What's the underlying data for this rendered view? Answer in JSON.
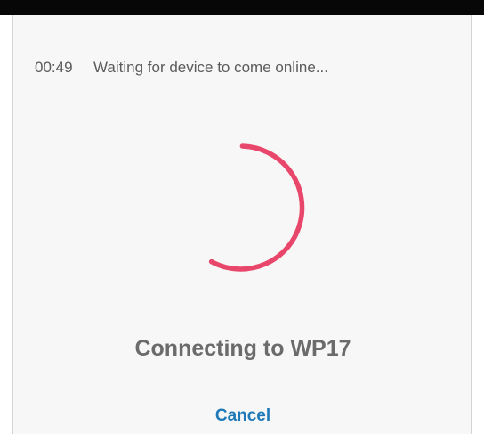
{
  "status": {
    "timer": "00:49",
    "message": "Waiting for device to come online..."
  },
  "spinner": {
    "icon": "loading-spinner-icon",
    "color": "#e8476b"
  },
  "dialog": {
    "title": "Connecting to WP17",
    "cancel_label": "Cancel"
  },
  "colors": {
    "accent": "#1e79b8",
    "background": "#f7f7f7",
    "top_bar": "#070707"
  }
}
